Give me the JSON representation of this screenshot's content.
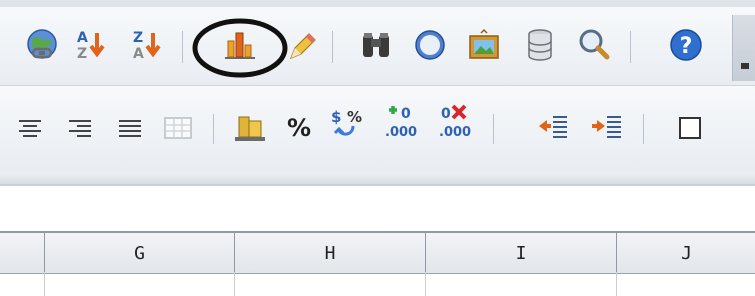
{
  "columns": [
    "G",
    "H",
    "I",
    "J"
  ],
  "sort": {
    "asc_top": "A",
    "asc_bottom": "Z",
    "desc_top": "Z",
    "desc_bottom": "A"
  },
  "format": {
    "percent": "%",
    "currency": "$",
    "add_decimal_place": "0",
    "thousands_sep": ".000"
  },
  "highlighted_button": "insert-chart"
}
